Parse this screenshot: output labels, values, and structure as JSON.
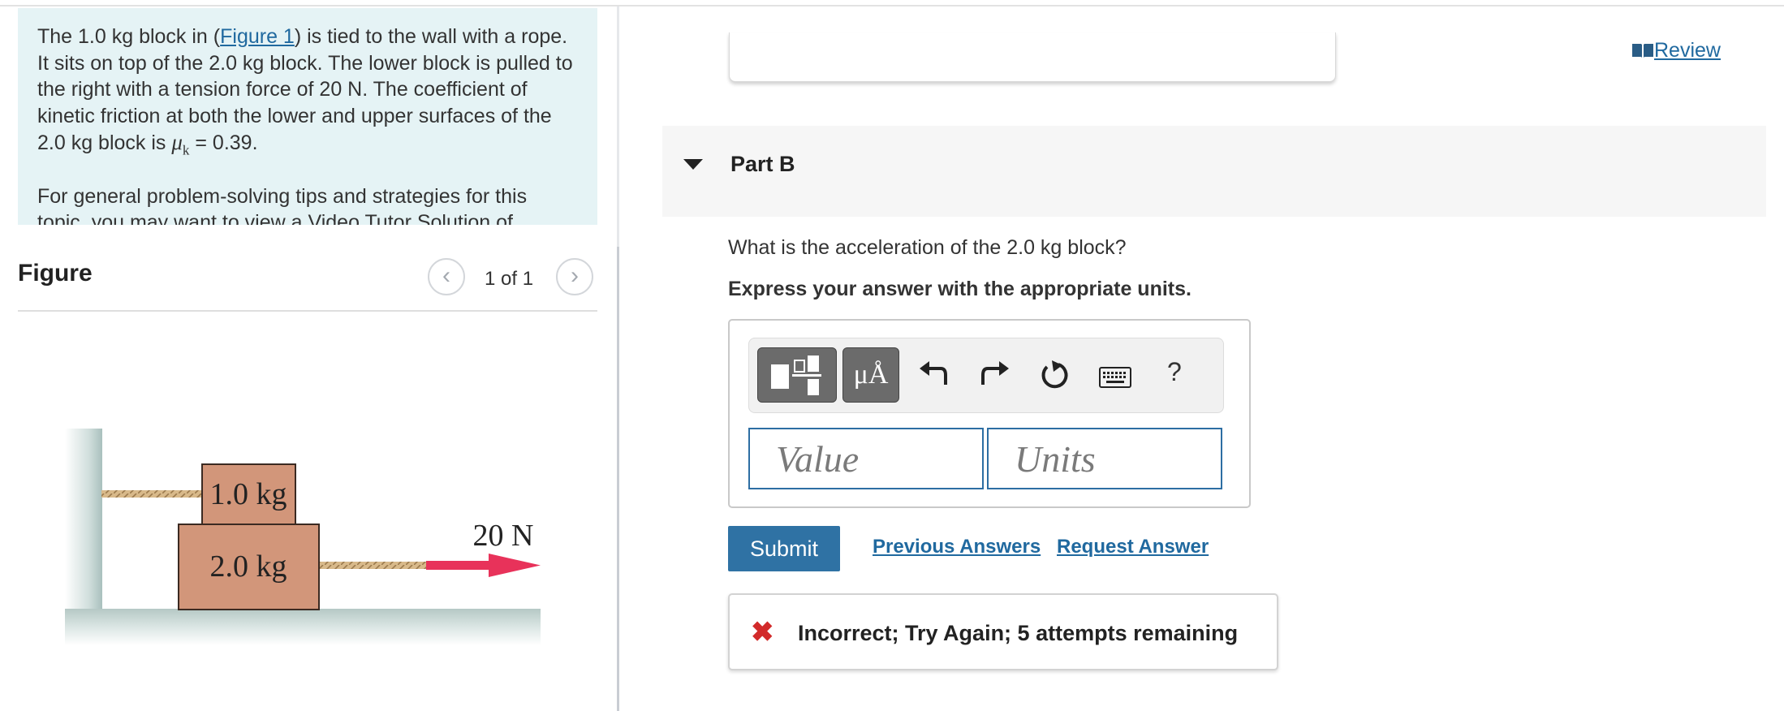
{
  "problem": {
    "p1_a": "The 1.0 kg block in (",
    "p1_link": "Figure 1",
    "p1_b": ") is tied to the wall with a rope. It sits on top of the 2.0 kg block. The lower block is pulled to the right with a tension force of 20 N. The coefficient of kinetic friction at both the lower and upper surfaces of the 2.0 kg block is ",
    "mu_symbol": "μ",
    "mu_sub": "k",
    "p1_c": " = 0.39.",
    "p2": "For general problem-solving tips and strategies for this topic, you may want to view a Video Tutor Solution of"
  },
  "figure_panel": {
    "title": "Figure",
    "counter": "1 of 1",
    "prev_icon": "chevron-left-icon",
    "next_icon": "chevron-right-icon"
  },
  "diagram": {
    "upper_block": "1.0 kg",
    "lower_block": "2.0 kg",
    "force_label": "20 N",
    "block_color": "#d2967a",
    "arrow_color": "#e8325a"
  },
  "header": {
    "review_label": "Review",
    "review_icon": "book-icon"
  },
  "part": {
    "title": "Part B",
    "question": "What is the acceleration of the 2.0 kg block?",
    "instruction": "Express your answer with the appropriate units."
  },
  "toolbar": {
    "template_icon": "fraction-template-icon",
    "units_label": "μÅ",
    "undo_icon": "undo-icon",
    "redo_icon": "redo-icon",
    "reset_icon": "reset-icon",
    "keyboard_icon": "keyboard-icon",
    "help_label": "?"
  },
  "inputs": {
    "value_placeholder": "Value",
    "units_placeholder": "Units"
  },
  "actions": {
    "submit_label": "Submit",
    "previous_answers": "Previous Answers",
    "request_answer": "Request Answer"
  },
  "feedback": {
    "icon": "x-mark-icon",
    "symbol": "✖",
    "text": "Incorrect; Try Again; 5 attempts remaining"
  },
  "colors": {
    "accent": "#2f72a4",
    "link": "#20699f",
    "error": "#d22a2a",
    "problem_bg": "#e5f3f5"
  }
}
